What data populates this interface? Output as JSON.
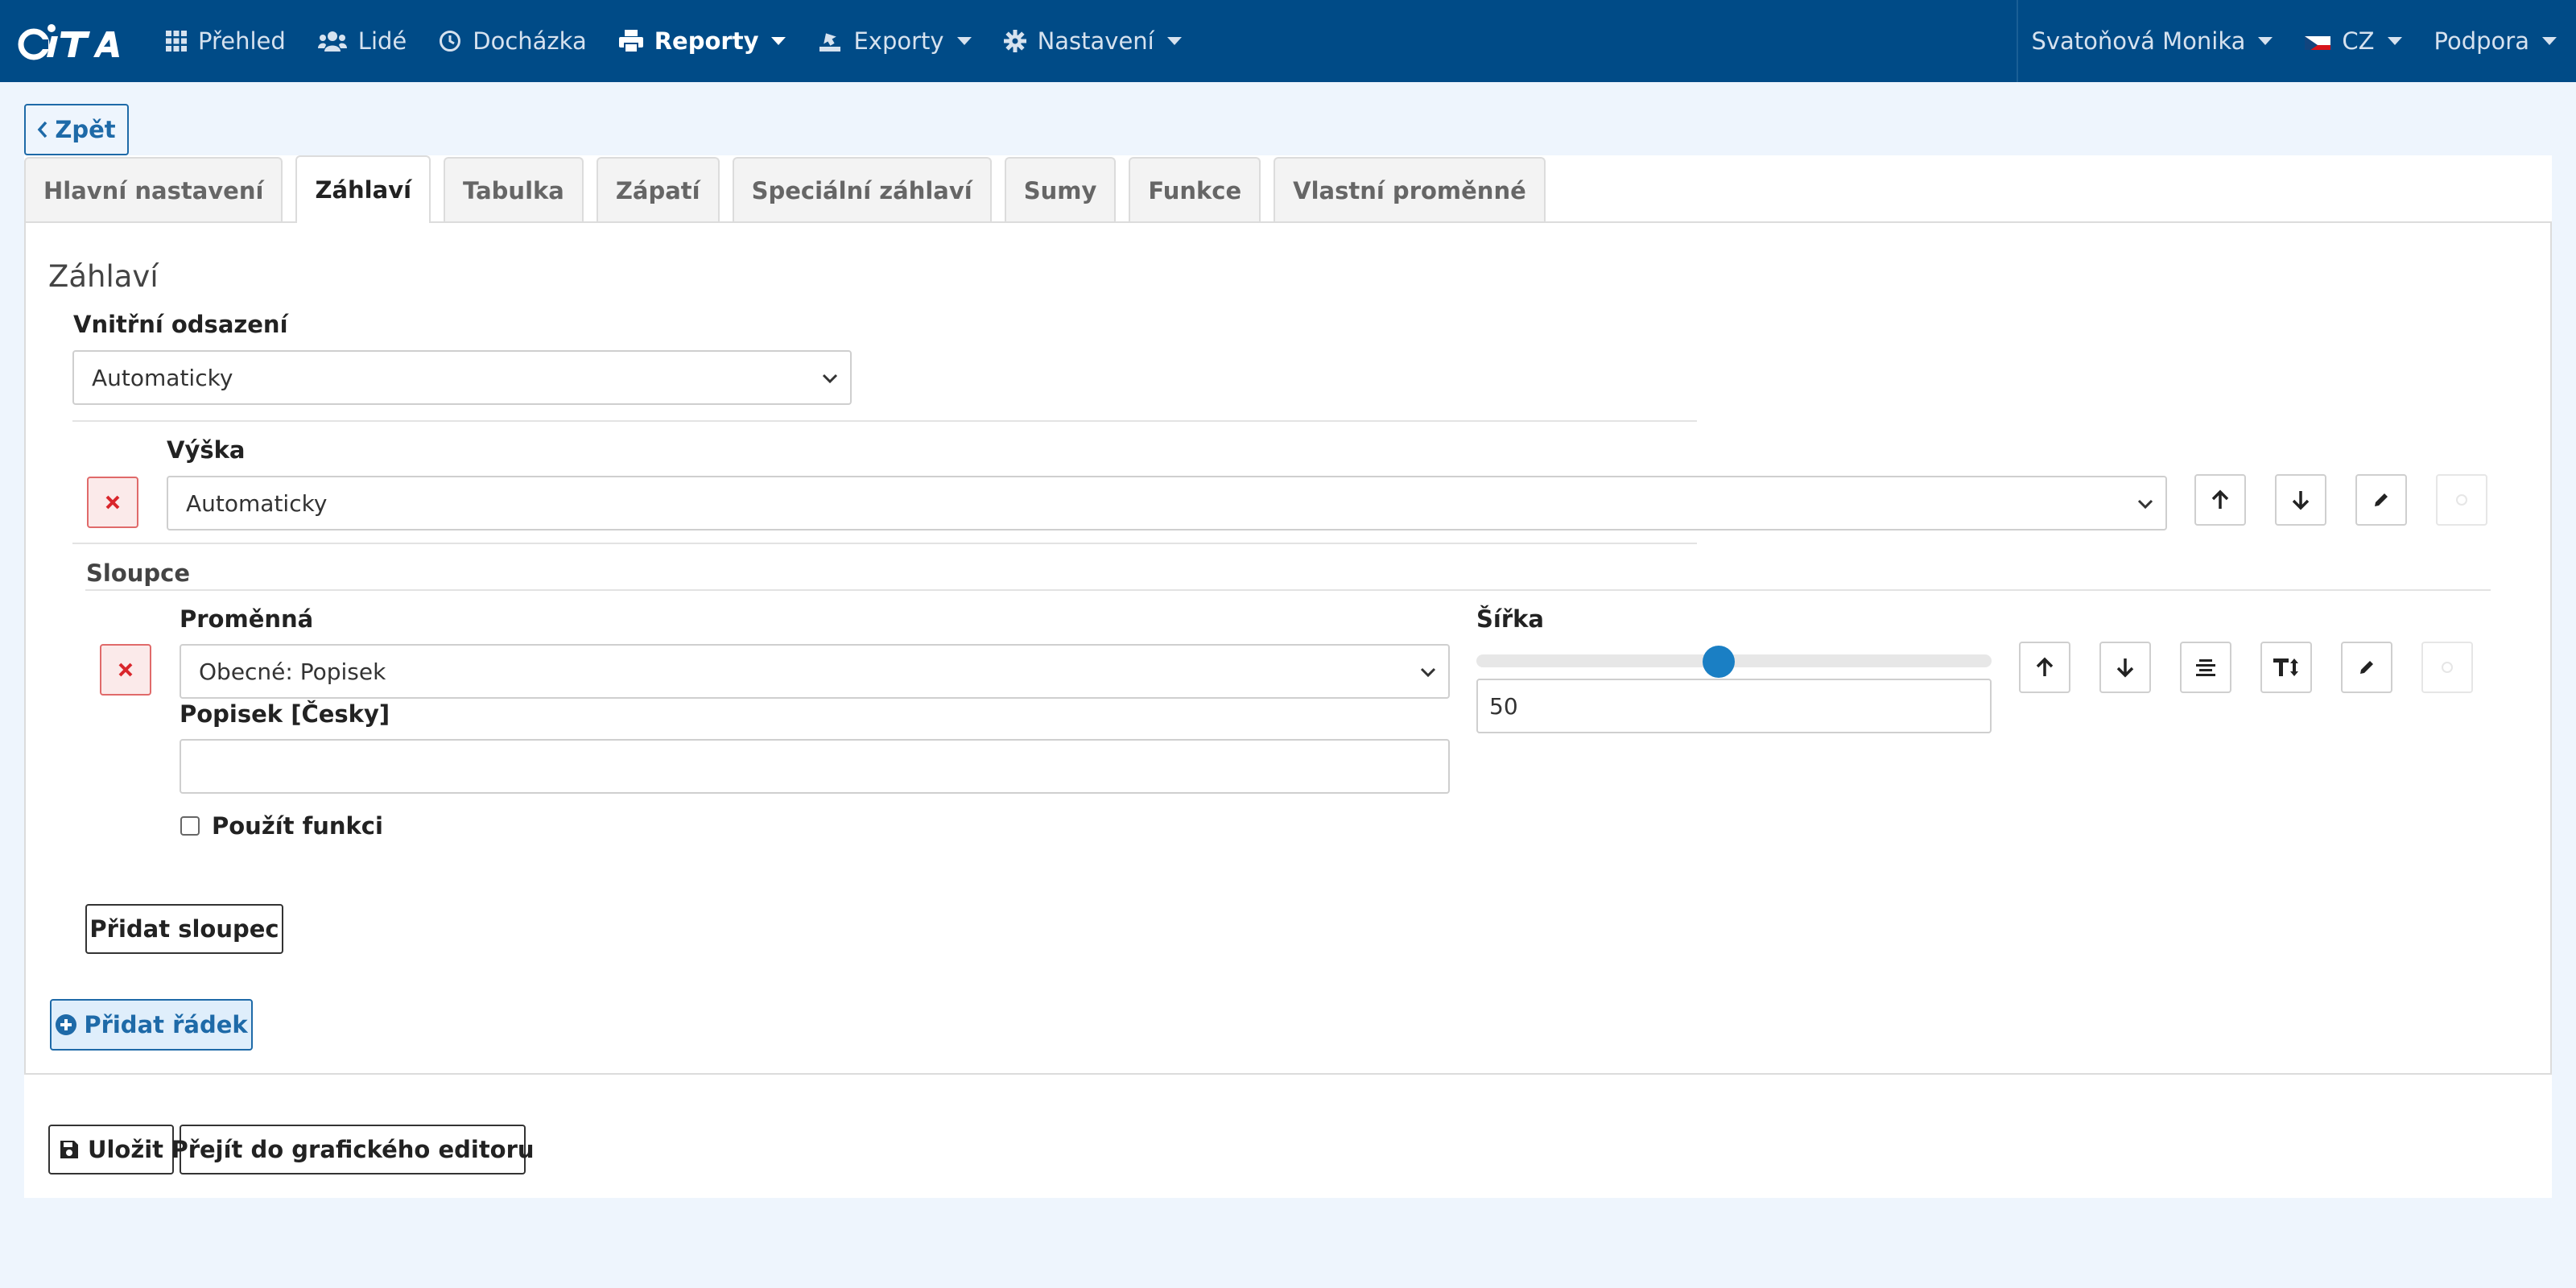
{
  "brand": {
    "logo_text": "CITA"
  },
  "nav": {
    "items": [
      {
        "label": "Přehled",
        "icon": "grid-icon"
      },
      {
        "label": "Lidé",
        "icon": "users-icon"
      },
      {
        "label": "Docházka",
        "icon": "clock-icon"
      },
      {
        "label": "Reporty",
        "icon": "printer-icon",
        "active": true
      },
      {
        "label": "Exporty",
        "icon": "export-icon"
      },
      {
        "label": "Nastavení",
        "icon": "gear-icon"
      }
    ],
    "user": "Svatoňová Monika",
    "language": "CZ",
    "support": "Podpora"
  },
  "back_label": "Zpět",
  "tabs": [
    {
      "label": "Hlavní nastavení"
    },
    {
      "label": "Záhlaví",
      "active": true
    },
    {
      "label": "Tabulka"
    },
    {
      "label": "Zápatí"
    },
    {
      "label": "Speciální záhlaví"
    },
    {
      "label": "Sumy"
    },
    {
      "label": "Funkce"
    },
    {
      "label": "Vlastní proměnné"
    }
  ],
  "section": {
    "title": "Záhlaví",
    "padding_label": "Vnitřní odsazení",
    "padding_value": "Automaticky",
    "row": {
      "height_label": "Výška",
      "height_value": "Automaticky"
    },
    "columns_label": "Sloupce",
    "column": {
      "variable_label": "Proměnná",
      "variable_value": "Obecné: Popisek",
      "caption_label": "Popisek [Česky]",
      "caption_value": "",
      "use_function_label": "Použít funkci",
      "use_function_checked": false,
      "width_label": "Šířka",
      "width_value": "50",
      "width_slider_fraction": 0.47
    },
    "add_column_label": "Přidat sloupec",
    "add_row_label": "Přidat řádek"
  },
  "footer": {
    "save_label": "Uložit",
    "graphic_editor_label": "Přejít do grafického editoru"
  },
  "colors": {
    "navbar": "#004b87",
    "accent": "#1e6aa8",
    "danger": "#e06a6a",
    "page_bg": "#eef5fd"
  }
}
